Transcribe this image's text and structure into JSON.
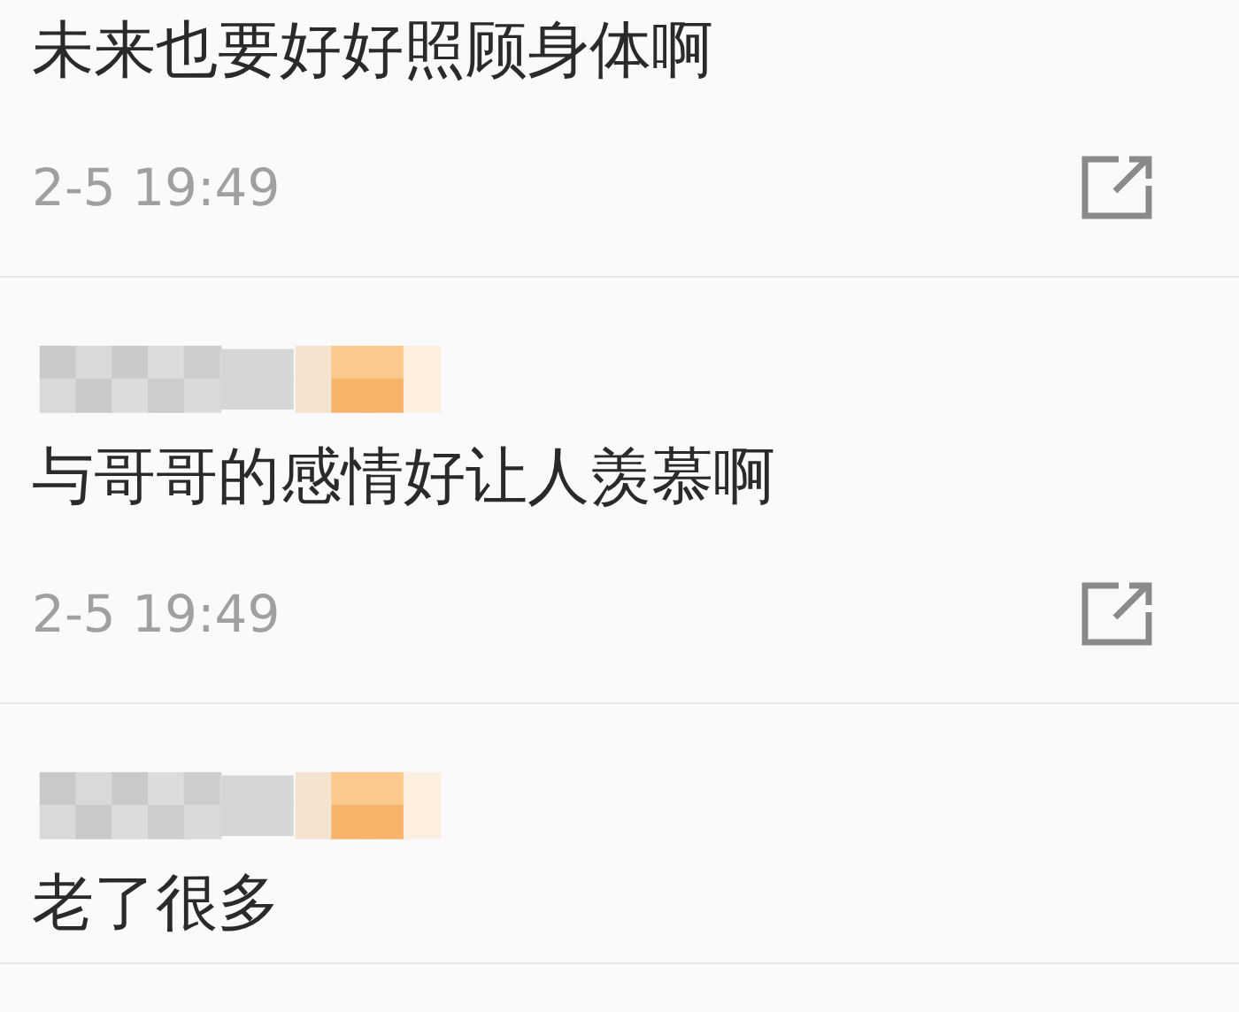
{
  "comments": [
    {
      "author_blurred": false,
      "text": "未来也要好好照顾身体啊",
      "time": "2-5 19:49"
    },
    {
      "author_blurred": true,
      "text": "与哥哥的感情好让人羡慕啊",
      "time": "2-5 19:49"
    },
    {
      "author_blurred": true,
      "text": "老了很多"
    }
  ]
}
